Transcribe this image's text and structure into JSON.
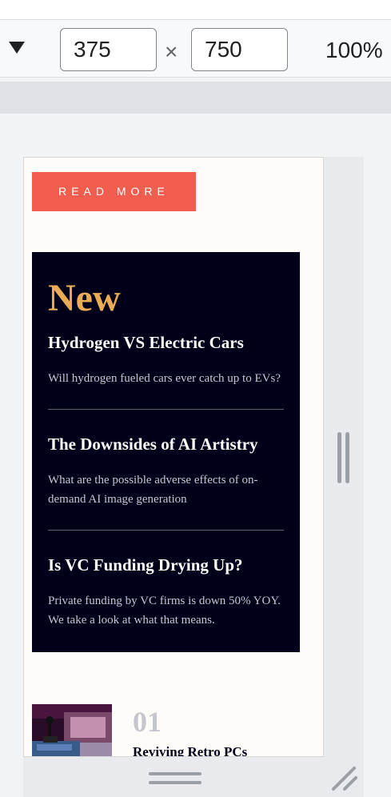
{
  "devtools": {
    "width_value": "375",
    "height_value": "750",
    "times_symbol": "×",
    "zoom": "100%",
    "colors": {
      "toolbar": "#f8f9fa",
      "band": "#dee1e6",
      "handle": "#e8eaed"
    }
  },
  "page": {
    "read_more_label": "READ MORE",
    "news_heading": "New",
    "items": [
      {
        "title": "Hydrogen VS Electric Cars",
        "text": "Will hydrogen fueled cars ever catch up to EVs?"
      },
      {
        "title": "The Downsides of AI Artistry",
        "text": "What are the possible adverse effects of on-demand AI image generation"
      },
      {
        "title": "Is VC Funding Drying Up?",
        "text": "Private funding by VC firms is down 50% YOY. We take a look at what that means."
      }
    ],
    "card": {
      "number": "01",
      "title": "Reviving Retro PCs"
    },
    "colors": {
      "accent": "#f15e50",
      "dark": "#00001a",
      "gold": "#e9ab53",
      "bg": "#fdfcf8"
    }
  }
}
